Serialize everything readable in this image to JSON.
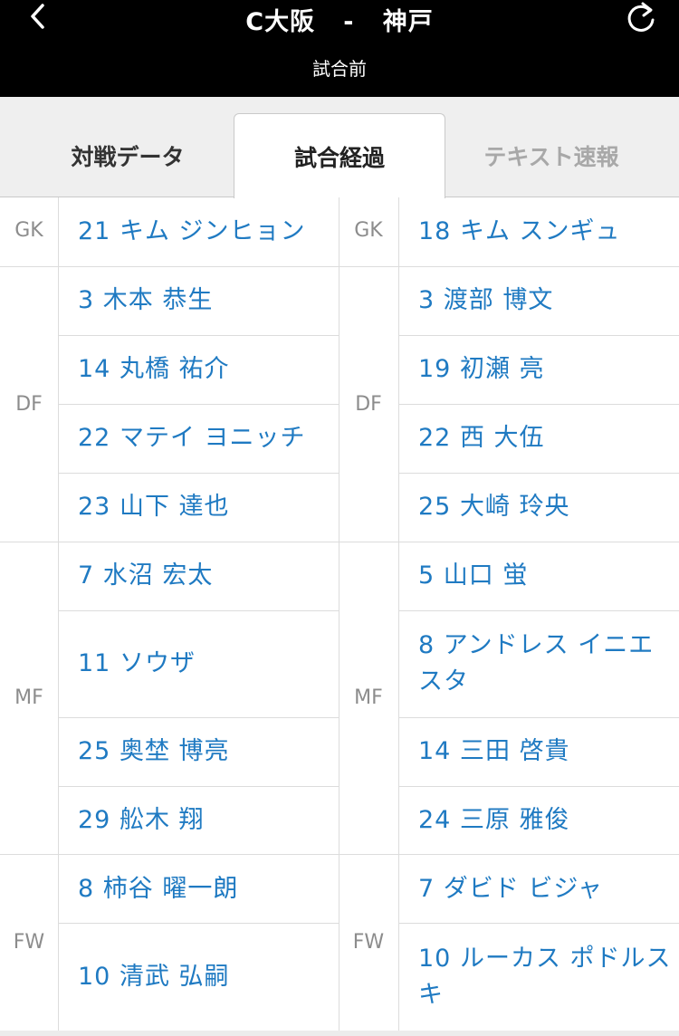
{
  "header": {
    "title": "C大阪   -   神戸",
    "status": "試合前"
  },
  "tabs": [
    {
      "label": "対戦データ",
      "active": false
    },
    {
      "label": "試合経過",
      "active": true
    },
    {
      "label": "テキスト速報",
      "active": false
    }
  ],
  "home": {
    "GK": [
      "21 キム ジンヒョン"
    ],
    "DF": [
      "3 木本 恭生",
      "14 丸橋 祐介",
      "22 マテイ ヨニッチ",
      "23 山下 達也"
    ],
    "MF": [
      "7 水沼 宏太",
      "11 ソウザ",
      "25 奥埜 博亮",
      "29 舩木 翔"
    ],
    "FW": [
      "8 柿谷 曜一朗",
      "10 清武 弘嗣"
    ]
  },
  "away": {
    "GK": [
      "18 キム スンギュ"
    ],
    "DF": [
      "3 渡部 博文",
      "19 初瀬 亮",
      "22 西 大伍",
      "25 大崎 玲央"
    ],
    "MF": [
      "5 山口 蛍",
      "8 アンドレス イニエスタ",
      "14 三田 啓貴",
      "24 三原 雅俊"
    ],
    "FW": [
      "7 ダビド ビジャ",
      "10 ルーカス ポドルスキ"
    ]
  },
  "positions": {
    "gk": "GK",
    "df": "DF",
    "mf": "MF",
    "fw": "FW"
  },
  "icons": {
    "back": "chevron-left-icon",
    "refresh": "refresh-icon"
  },
  "colors": {
    "header_bg": "#000000",
    "player_link": "#1f7ac2",
    "position_label": "#8c8c8c",
    "tab_bg": "#efefef"
  }
}
